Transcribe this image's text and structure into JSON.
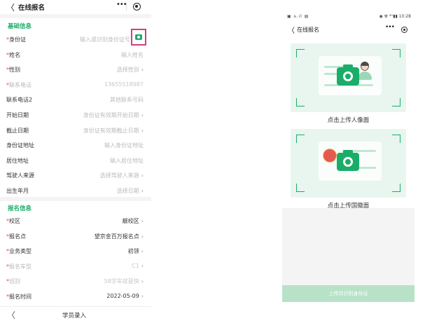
{
  "left": {
    "nav": {
      "back_glyph": "〈",
      "title": "在线报名",
      "more_glyph": "•••",
      "target_icon": "target-icon"
    },
    "sections": {
      "basic": "基础信息",
      "signup": "报名信息"
    },
    "basic_rows": [
      {
        "label": "身份证",
        "required": true,
        "value": "输入或识别身份证号",
        "chev": false
      },
      {
        "label": "姓名",
        "required": true,
        "value": "输入姓名",
        "chev": false
      },
      {
        "label": "性别",
        "required": true,
        "value": "选择性别",
        "chev": true
      },
      {
        "label": "联系电话",
        "required": true,
        "value": "13655518987",
        "chev": false,
        "dim": true
      },
      {
        "label": "联系电话2",
        "required": false,
        "value": "其他联系号码",
        "chev": false
      },
      {
        "label": "开始日期",
        "required": false,
        "value": "身份证有效期开始日期",
        "chev": true
      },
      {
        "label": "截止日期",
        "required": false,
        "value": "身份证有效期截止日期",
        "chev": true
      },
      {
        "label": "身份证地址",
        "required": false,
        "value": "输入身份证地址",
        "chev": false
      },
      {
        "label": "居住地址",
        "required": false,
        "value": "输入居住地址",
        "chev": false
      },
      {
        "label": "驾驶人来源",
        "required": false,
        "value": "选择驾驶人来源",
        "chev": true
      },
      {
        "label": "出生年月",
        "required": false,
        "value": "选择日期",
        "chev": true
      }
    ],
    "signup_rows": [
      {
        "label": "校区",
        "required": true,
        "value": "靓校区",
        "chev": true,
        "dark": true
      },
      {
        "label": "报名点",
        "required": true,
        "value": "望京金百万报名点",
        "chev": true,
        "dark": true
      },
      {
        "label": "业务类型",
        "required": true,
        "value": "初领",
        "chev": true,
        "dark": true
      },
      {
        "label": "报名车型",
        "required": true,
        "value": "C1",
        "chev": true,
        "dim": true
      },
      {
        "label": "班别",
        "required": true,
        "value": "58学车就是快",
        "chev": true,
        "dim": true
      },
      {
        "label": "报名时间",
        "required": true,
        "value": "2022-05-09",
        "chev": true,
        "dark": true
      }
    ],
    "chev_glyph": "›",
    "bottom": {
      "back_glyph": "〈",
      "label": "学员录入"
    }
  },
  "right": {
    "status": {
      "left": "▣ ᵴ.ıl ▤",
      "right": "◉ ☢ ⁴ᴳ▮▮ 10:28"
    },
    "nav": {
      "back_glyph": "〈",
      "title": "在线报名",
      "more_glyph": "•••"
    },
    "card1_caption": "点击上传人像面",
    "card2_caption": "点击上传国徽面",
    "submit_label": "上传并识别身份证"
  },
  "colors": {
    "accent": "#1aad6a",
    "required": "#e24a4a",
    "highlight": "#d63c7c"
  }
}
